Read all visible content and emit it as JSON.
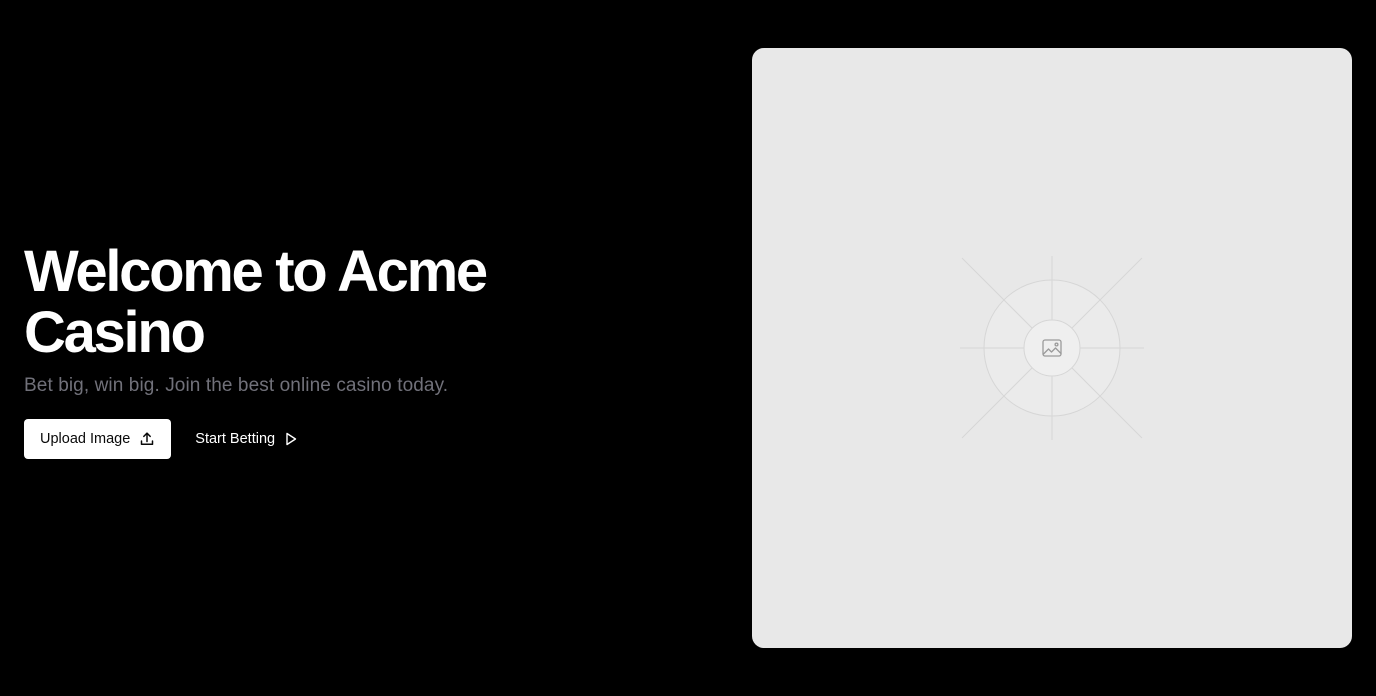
{
  "hero": {
    "title": "Welcome to Acme Casino",
    "subtitle": "Bet big, win big. Join the best online casino today."
  },
  "actions": {
    "upload_label": "Upload Image",
    "upload_icon": "upload-icon",
    "start_label": "Start Betting",
    "start_icon": "play-icon"
  },
  "image_placeholder": {
    "icon": "image-icon"
  },
  "colors": {
    "background": "#000000",
    "title": "#ffffff",
    "subtitle": "#71717a",
    "primary_button_bg": "#ffffff",
    "primary_button_text": "#0a0a0a",
    "panel_bg": "#e8e8e8"
  }
}
